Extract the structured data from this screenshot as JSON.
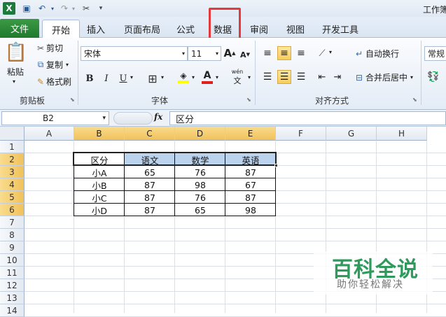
{
  "titlebar": {
    "title": "工作簿"
  },
  "tabs": {
    "file": "文件",
    "home": "开始",
    "insert": "插入",
    "page_layout": "页面布局",
    "formulas": "公式",
    "data": "数据",
    "review": "审阅",
    "view": "视图",
    "developer": "开发工具"
  },
  "ribbon": {
    "clipboard": {
      "paste": "粘贴",
      "cut": "剪切",
      "copy": "复制",
      "format_painter": "格式刷",
      "label": "剪贴板"
    },
    "font": {
      "name": "宋体",
      "size": "11",
      "bold": "B",
      "italic": "I",
      "underline": "U",
      "label": "字体",
      "font_color_glyph": "A",
      "grow_glyph": "A",
      "shrink_glyph": "A",
      "phonetic_glyph": "wén"
    },
    "alignment": {
      "wrap_text": "自动换行",
      "merge_center": "合并后居中",
      "label": "对齐方式"
    },
    "number": {
      "format": "常规"
    }
  },
  "formula_bar": {
    "name_box": "B2",
    "fx": "fx",
    "content": "区分"
  },
  "columns": [
    "A",
    "B",
    "C",
    "D",
    "E",
    "F",
    "G",
    "H"
  ],
  "rows": [
    "1",
    "2",
    "3",
    "4",
    "5",
    "6",
    "7",
    "8",
    "9",
    "10",
    "11",
    "12",
    "13",
    "14"
  ],
  "table": {
    "headers": [
      "区分",
      "语文",
      "数学",
      "英语"
    ],
    "rows": [
      [
        "小A",
        "65",
        "76",
        "87"
      ],
      [
        "小B",
        "87",
        "98",
        "67"
      ],
      [
        "小C",
        "87",
        "76",
        "87"
      ],
      [
        "小D",
        "87",
        "65",
        "98"
      ]
    ]
  },
  "watermark": {
    "title": "百科全说",
    "subtitle": "助你轻松解决"
  },
  "colors": {
    "highlight": "#e23a3a",
    "file_tab": "#1f7a2c",
    "header_fill": "#bcd3ee",
    "selected_header": "#f1c15a"
  }
}
